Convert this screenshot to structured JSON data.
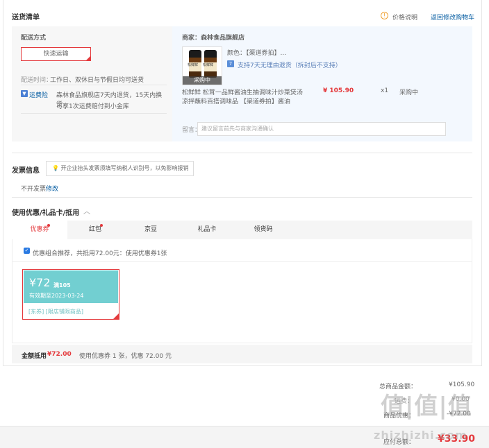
{
  "delivery": {
    "title": "送货清单",
    "price_note": "价格说明",
    "back_to_cart": "返回修改购物车",
    "method_label": "配送方式",
    "method_value": "快速运输",
    "time_label": "配送时间：",
    "time_value": "工作日、双休日与节假日均可送货",
    "insurance_label": "运费险",
    "insurance_text_1": "森林食品旗舰店7天内退货，15天内换货，",
    "insurance_text_2": "可享1次运费赔付到小金库"
  },
  "shop": {
    "name": "商家：森林食品旗舰店",
    "color_label": "颜色：",
    "color_value": "【渠道券拍】...",
    "return_policy": "支持7天无理由退货（拆封后不支持）",
    "product_name_1": "松鲜鲜 松茸一品鲜酱油生抽调味汁炒菜煲汤",
    "product_name_2": "凉拌蘸料百搭调味品 【渠道券拍】酱油",
    "price": "¥ 105.90",
    "qty": "x1",
    "status": "采购中",
    "img_badge": "采购中",
    "bottle_label": "松鲜鲜",
    "remark_label": "留言：",
    "remark_placeholder": "建议留言前先与商家沟通确认"
  },
  "invoice": {
    "title": "发票信息",
    "tip": "开企业抬头发票须填写纳税人识别号，以免影响报销",
    "value": "不开发票",
    "edit": "修改"
  },
  "discount": {
    "title": "使用优惠/礼品卡/抵用",
    "tabs": [
      {
        "label": "优惠券",
        "active": true,
        "dot": true
      },
      {
        "label": "红包",
        "active": false,
        "dot": true
      },
      {
        "label": "京豆",
        "active": false,
        "dot": false
      },
      {
        "label": "礼品卡",
        "active": false,
        "dot": false
      },
      {
        "label": "领货码",
        "active": false,
        "dot": false
      }
    ],
    "combo_text": "优惠组合推荐，共抵用72.00元：使用优惠券1张",
    "coupon": {
      "amount": "¥72",
      "condition": "满105",
      "expiry": "有效期至2023-03-24",
      "scope": "[东券] [限店铺限商品]"
    },
    "sum_label": "金额抵用",
    "sum_value": "¥72.00",
    "sum_desc": "使用优惠券 1 张，优惠 72.00 元"
  },
  "totals": {
    "goods_label": "总商品金额：",
    "goods_value": "¥105.90",
    "freight_label": "运费：",
    "freight_value": "¥0.00",
    "discount_label": "商品优惠：",
    "discount_value": "-¥72.00",
    "payable_label": "应付总额：",
    "payable_value": "¥33.90"
  },
  "watermark": {
    "main": "值|值|值",
    "url": "zhizhizhi.com"
  },
  "colors": {
    "accent_red": "#e4393c",
    "link_blue": "#005aa0",
    "coupon_teal": "#72cfd1"
  }
}
